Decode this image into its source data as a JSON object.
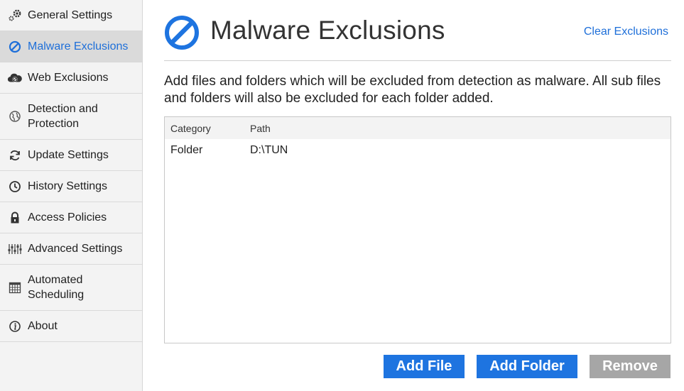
{
  "sidebar": {
    "items": [
      {
        "label": "General Settings",
        "icon": "gears-icon"
      },
      {
        "label": "Malware Exclusions",
        "icon": "no-entry-icon",
        "active": true
      },
      {
        "label": "Web Exclusions",
        "icon": "cloud-block-icon"
      },
      {
        "label": "Detection and Protection",
        "icon": "globe-icon"
      },
      {
        "label": "Update Settings",
        "icon": "refresh-icon"
      },
      {
        "label": "History Settings",
        "icon": "clock-icon"
      },
      {
        "label": "Access Policies",
        "icon": "lock-icon"
      },
      {
        "label": "Advanced Settings",
        "icon": "sliders-icon"
      },
      {
        "label": "Automated Scheduling",
        "icon": "calendar-icon"
      },
      {
        "label": "About",
        "icon": "info-icon"
      }
    ]
  },
  "header": {
    "title": "Malware Exclusions",
    "clear_link": "Clear Exclusions"
  },
  "description": "Add files and folders which will be excluded from detection as malware. All sub files and folders will also be excluded for each folder added.",
  "table": {
    "columns": [
      "Category",
      "Path"
    ],
    "rows": [
      {
        "category": "Folder",
        "path": "D:\\TUN"
      }
    ]
  },
  "buttons": {
    "add_file": "Add File",
    "add_folder": "Add Folder",
    "remove": "Remove"
  },
  "colors": {
    "accent": "#1e74e0",
    "link": "#1e6fd9",
    "disabled_button": "#a6a6a6",
    "active_nav_bg": "#dadada"
  }
}
